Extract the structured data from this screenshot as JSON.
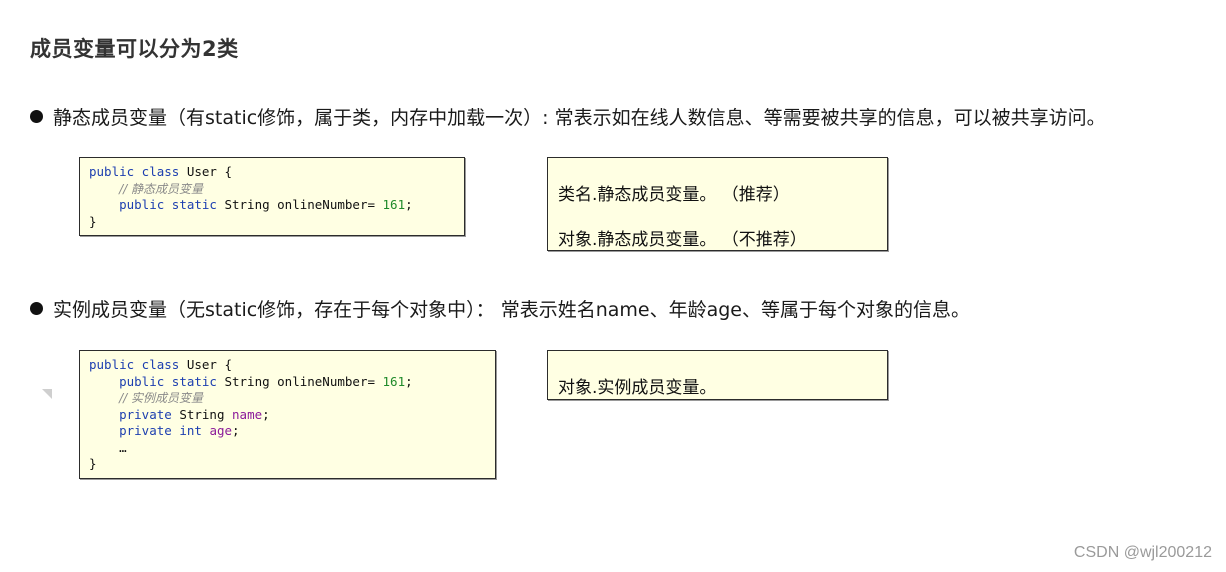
{
  "title": "成员变量可以分为2类",
  "sections": [
    {
      "bullet": "静态成员变量（有static修饰，属于类，内存中加载一次）: 常表示如在线人数信息、等需要被共享的信息，可以被共享访问。",
      "code": {
        "line1_kw": "public class",
        "line1_name": " User {",
        "comment": "// 静态成员变量",
        "line3_kw": "public static",
        "line3_rest": " String onlineNumber= ",
        "line3_num": "161",
        "line3_end": ";",
        "close": "}"
      },
      "usage": [
        "类名.静态成员变量。 （推荐）",
        "对象.静态成员变量。 （不推荐）"
      ]
    },
    {
      "bullet": "实例成员变量（无static修饰，存在于每个对象中）： 常表示姓名name、年龄age、等属于每个对象的信息。",
      "code": {
        "line1_kw": "public class",
        "line1_name": " User {",
        "line2_kw": "public static",
        "line2_rest": " String onlineNumber= ",
        "line2_num": "161",
        "line2_end": ";",
        "comment": "// 实例成员变量",
        "line4_kw": "private",
        "line4_rest": " String ",
        "line4_field": "name",
        "line4_end": ";",
        "line5_kw": "private int",
        "line5_rest": " ",
        "line5_field": "age",
        "line5_end": ";",
        "ellipsis": "…",
        "close": "}"
      },
      "usage": [
        "对象.实例成员变量。"
      ]
    }
  ],
  "watermark": "CSDN @wjl200212"
}
